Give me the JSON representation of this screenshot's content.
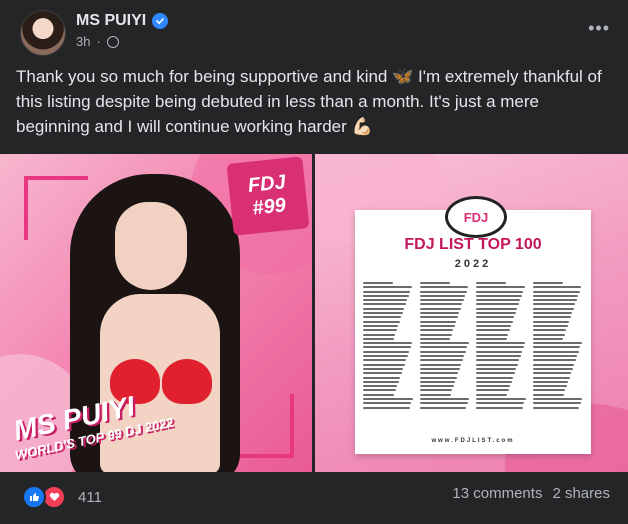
{
  "post": {
    "author": "MS PUIYI",
    "time": "3h",
    "text": "Thank you so much for being supportive and kind 🦋 I'm extremely thankful of this listing despite being debuted in less than a month. It's just a mere beginning and I will continue working harder 💪🏻"
  },
  "photo_left": {
    "badge_logo": "FDJ",
    "badge_number": "#99",
    "caption_main": "MS PUIYI",
    "caption_sub": "WORLD'S TOP 99 DJ 2022"
  },
  "photo_right": {
    "logo_text": "FDJ",
    "title": "FDJ LIST TOP 100",
    "year": "2022",
    "url": "www.FDJLIST.com"
  },
  "footer": {
    "reactions_count": "411",
    "comments": "13 comments",
    "shares": "2 shares"
  },
  "icons": {
    "verified": "verified-badge-icon",
    "audience": "globe-icon",
    "more": "more-options-icon",
    "like": "like-reaction-icon",
    "love": "love-reaction-icon"
  },
  "colors": {
    "background": "#242526",
    "text": "#e4e6eb",
    "muted": "#b0b3b8",
    "accent": "#2d88ff",
    "pink": "#e8367f"
  }
}
